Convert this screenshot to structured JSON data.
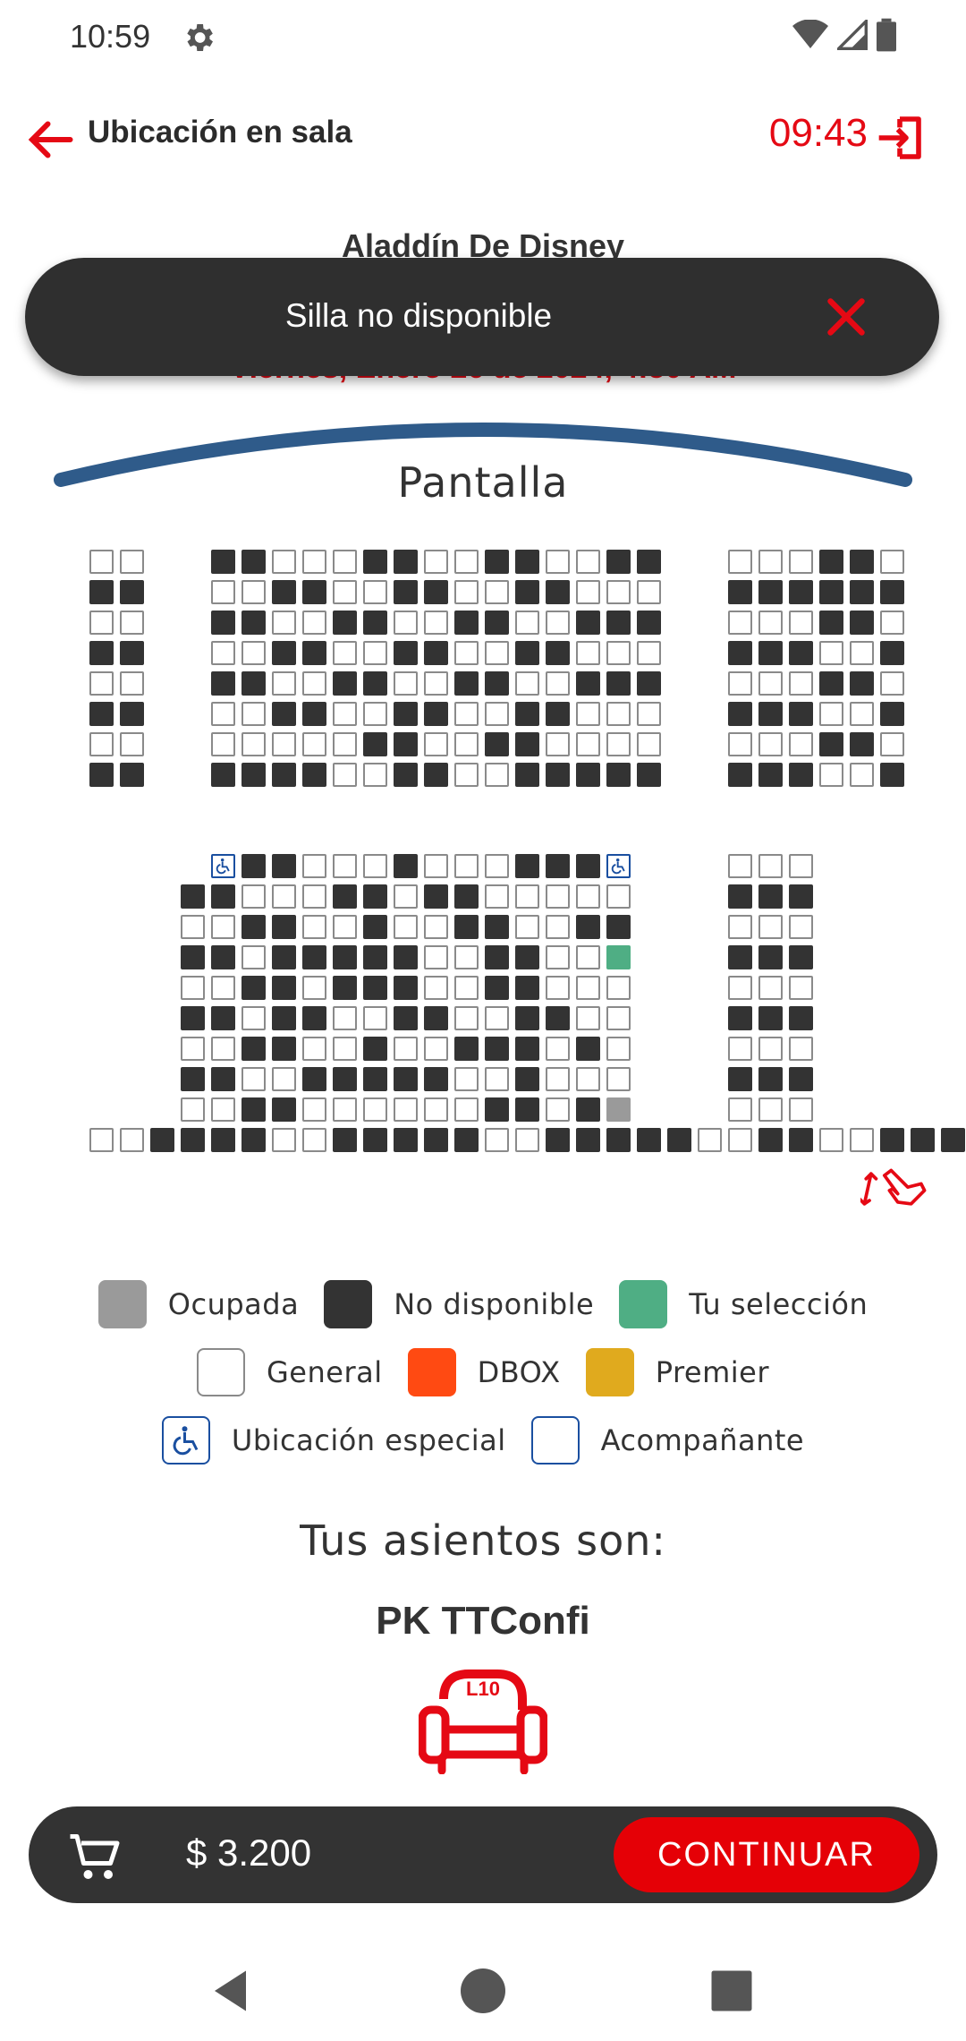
{
  "status_bar": {
    "time": "10:59",
    "icons": [
      "gear-icon",
      "wifi-icon",
      "signal-icon",
      "battery-icon"
    ]
  },
  "header": {
    "title": "Ubicación en sala",
    "timer": "09:43"
  },
  "movie": {
    "title": "Aladdín De Disney",
    "date": "Viernes, Enero 26 de 2024, 4:50 AM"
  },
  "toast": {
    "message": "Silla no disponible"
  },
  "screen": {
    "label": "Pantalla"
  },
  "seat_map": {
    "top_left": [
      "gg",
      "nn",
      "gg",
      "nn",
      "gg",
      "nn",
      "gg",
      "nn"
    ],
    "top_center": [
      "nngggnnggnnggnn",
      "ggnnggnnggnnggg",
      "nnggnnggnnggnnn",
      "ggnnggnnggnnggg",
      "nnggnnggnnggnnn",
      "ggnnggnnggnnggg",
      "gggggnnggnngggg",
      "nnnnggnnggnnnnn"
    ],
    "top_right": [
      "gggnng",
      "nnnnnn",
      "gggnng",
      "nnnggn",
      "gggnng",
      "nnnggn",
      "gggnng",
      "nnnggn"
    ],
    "bottom_center": [
      " wnngggngggnnnw ",
      "nngggnngnnggggg",
      "ggnnggnggnnggnn",
      "nngnnnnnggnnggs",
      "ggnngnnnggnnggg",
      "nngnnggnnggnngg",
      "ggnnggnggnnngng",
      "nnggnnnnnggnggg",
      "ggnnggggggnngno"
    ],
    "bottom_right": [
      "ggg",
      "nnn",
      "ggg",
      "nnn",
      "ggg",
      "nnn",
      "ggg",
      "nnn",
      "ggg"
    ],
    "bottom_row": "ggnnnnggnnnnnggnnnnnggnnggnnn"
  },
  "legend": [
    {
      "label": "Ocupada",
      "color": "#9a9a9a"
    },
    {
      "label": "No disponible",
      "color": "#333333"
    },
    {
      "label": "Tu selección",
      "color": "#4fae84"
    },
    {
      "label": "General",
      "color": "#ffffff"
    },
    {
      "label": "DBOX",
      "color": "#ff4a12"
    },
    {
      "label": "Premier",
      "color": "#e0aa1e"
    },
    {
      "label": "Ubicación especial",
      "color": "#1a4fa0",
      "icon": "wheelchair-icon"
    },
    {
      "label": "Acompañante",
      "color": "#1a4fa0"
    }
  ],
  "selection": {
    "title": "Tus asientos son:",
    "user": "PK TTConfi",
    "seat": "L10"
  },
  "cart": {
    "price": "$ 3.200",
    "continue_label": "CONTINUAR"
  },
  "colors": {
    "accent": "#e50914",
    "dark": "#333333",
    "selected": "#4fae84",
    "occupied": "#9a9a9a"
  }
}
